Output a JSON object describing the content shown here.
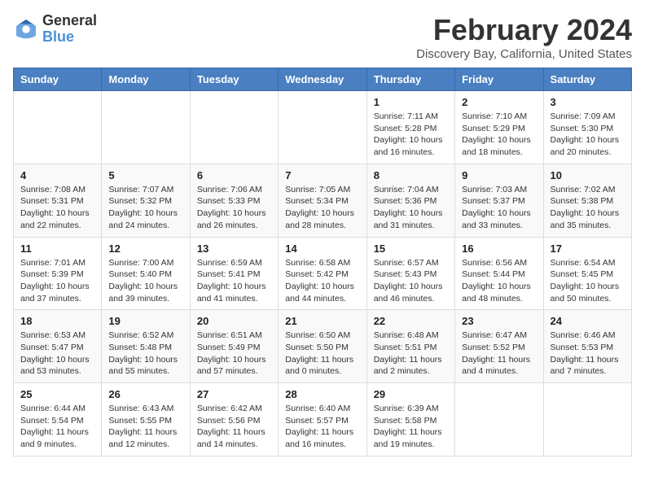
{
  "header": {
    "logo_general": "General",
    "logo_blue": "Blue",
    "main_title": "February 2024",
    "subtitle": "Discovery Bay, California, United States"
  },
  "columns": [
    "Sunday",
    "Monday",
    "Tuesday",
    "Wednesday",
    "Thursday",
    "Friday",
    "Saturday"
  ],
  "weeks": [
    [
      {
        "day": "",
        "info": ""
      },
      {
        "day": "",
        "info": ""
      },
      {
        "day": "",
        "info": ""
      },
      {
        "day": "",
        "info": ""
      },
      {
        "day": "1",
        "info": "Sunrise: 7:11 AM\nSunset: 5:28 PM\nDaylight: 10 hours\nand 16 minutes."
      },
      {
        "day": "2",
        "info": "Sunrise: 7:10 AM\nSunset: 5:29 PM\nDaylight: 10 hours\nand 18 minutes."
      },
      {
        "day": "3",
        "info": "Sunrise: 7:09 AM\nSunset: 5:30 PM\nDaylight: 10 hours\nand 20 minutes."
      }
    ],
    [
      {
        "day": "4",
        "info": "Sunrise: 7:08 AM\nSunset: 5:31 PM\nDaylight: 10 hours\nand 22 minutes."
      },
      {
        "day": "5",
        "info": "Sunrise: 7:07 AM\nSunset: 5:32 PM\nDaylight: 10 hours\nand 24 minutes."
      },
      {
        "day": "6",
        "info": "Sunrise: 7:06 AM\nSunset: 5:33 PM\nDaylight: 10 hours\nand 26 minutes."
      },
      {
        "day": "7",
        "info": "Sunrise: 7:05 AM\nSunset: 5:34 PM\nDaylight: 10 hours\nand 28 minutes."
      },
      {
        "day": "8",
        "info": "Sunrise: 7:04 AM\nSunset: 5:36 PM\nDaylight: 10 hours\nand 31 minutes."
      },
      {
        "day": "9",
        "info": "Sunrise: 7:03 AM\nSunset: 5:37 PM\nDaylight: 10 hours\nand 33 minutes."
      },
      {
        "day": "10",
        "info": "Sunrise: 7:02 AM\nSunset: 5:38 PM\nDaylight: 10 hours\nand 35 minutes."
      }
    ],
    [
      {
        "day": "11",
        "info": "Sunrise: 7:01 AM\nSunset: 5:39 PM\nDaylight: 10 hours\nand 37 minutes."
      },
      {
        "day": "12",
        "info": "Sunrise: 7:00 AM\nSunset: 5:40 PM\nDaylight: 10 hours\nand 39 minutes."
      },
      {
        "day": "13",
        "info": "Sunrise: 6:59 AM\nSunset: 5:41 PM\nDaylight: 10 hours\nand 41 minutes."
      },
      {
        "day": "14",
        "info": "Sunrise: 6:58 AM\nSunset: 5:42 PM\nDaylight: 10 hours\nand 44 minutes."
      },
      {
        "day": "15",
        "info": "Sunrise: 6:57 AM\nSunset: 5:43 PM\nDaylight: 10 hours\nand 46 minutes."
      },
      {
        "day": "16",
        "info": "Sunrise: 6:56 AM\nSunset: 5:44 PM\nDaylight: 10 hours\nand 48 minutes."
      },
      {
        "day": "17",
        "info": "Sunrise: 6:54 AM\nSunset: 5:45 PM\nDaylight: 10 hours\nand 50 minutes."
      }
    ],
    [
      {
        "day": "18",
        "info": "Sunrise: 6:53 AM\nSunset: 5:47 PM\nDaylight: 10 hours\nand 53 minutes."
      },
      {
        "day": "19",
        "info": "Sunrise: 6:52 AM\nSunset: 5:48 PM\nDaylight: 10 hours\nand 55 minutes."
      },
      {
        "day": "20",
        "info": "Sunrise: 6:51 AM\nSunset: 5:49 PM\nDaylight: 10 hours\nand 57 minutes."
      },
      {
        "day": "21",
        "info": "Sunrise: 6:50 AM\nSunset: 5:50 PM\nDaylight: 11 hours\nand 0 minutes."
      },
      {
        "day": "22",
        "info": "Sunrise: 6:48 AM\nSunset: 5:51 PM\nDaylight: 11 hours\nand 2 minutes."
      },
      {
        "day": "23",
        "info": "Sunrise: 6:47 AM\nSunset: 5:52 PM\nDaylight: 11 hours\nand 4 minutes."
      },
      {
        "day": "24",
        "info": "Sunrise: 6:46 AM\nSunset: 5:53 PM\nDaylight: 11 hours\nand 7 minutes."
      }
    ],
    [
      {
        "day": "25",
        "info": "Sunrise: 6:44 AM\nSunset: 5:54 PM\nDaylight: 11 hours\nand 9 minutes."
      },
      {
        "day": "26",
        "info": "Sunrise: 6:43 AM\nSunset: 5:55 PM\nDaylight: 11 hours\nand 12 minutes."
      },
      {
        "day": "27",
        "info": "Sunrise: 6:42 AM\nSunset: 5:56 PM\nDaylight: 11 hours\nand 14 minutes."
      },
      {
        "day": "28",
        "info": "Sunrise: 6:40 AM\nSunset: 5:57 PM\nDaylight: 11 hours\nand 16 minutes."
      },
      {
        "day": "29",
        "info": "Sunrise: 6:39 AM\nSunset: 5:58 PM\nDaylight: 11 hours\nand 19 minutes."
      },
      {
        "day": "",
        "info": ""
      },
      {
        "day": "",
        "info": ""
      }
    ]
  ]
}
